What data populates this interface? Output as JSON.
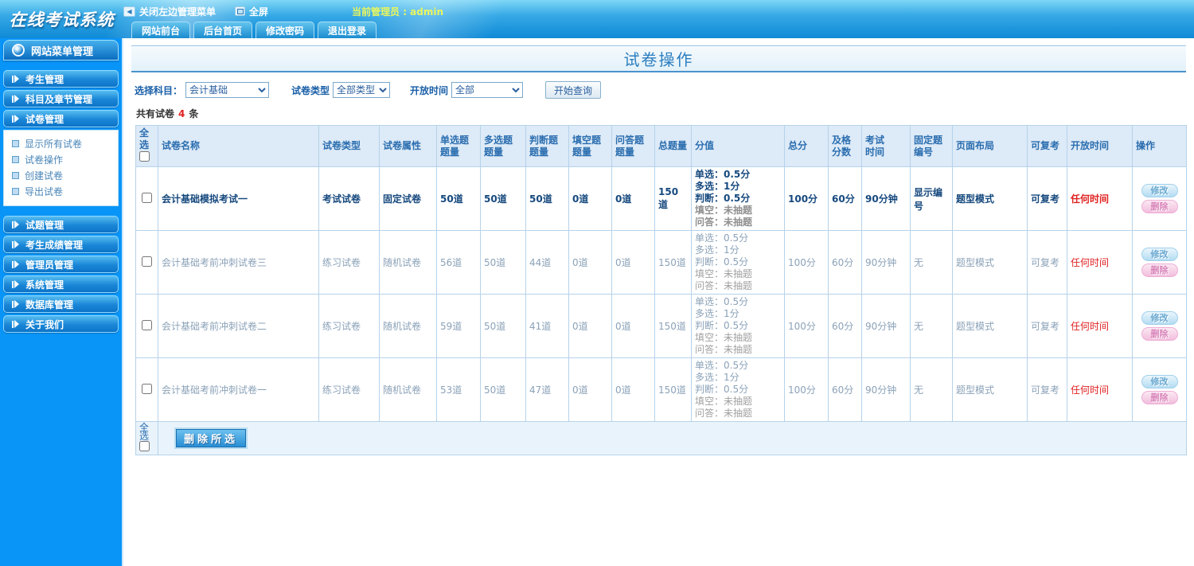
{
  "app": {
    "logo": "在线考试系统"
  },
  "topbar": {
    "close_menu": "关闭左边管理菜单",
    "fullscreen": "全屏",
    "admin_label": "当前管理员 : admin",
    "tabs": [
      "网站前台",
      "后台首页",
      "修改密码",
      "退出登录"
    ]
  },
  "sidebar": {
    "header": "网站菜单管理",
    "items": [
      {
        "label": "考生管理"
      },
      {
        "label": "科目及章节管理"
      },
      {
        "label": "试卷管理",
        "children": [
          "显示所有试卷",
          "试卷操作",
          "创建试卷",
          "导出试卷"
        ]
      },
      {
        "label": "试题管理"
      },
      {
        "label": "考生成绩管理"
      },
      {
        "label": "管理员管理"
      },
      {
        "label": "系统管理"
      },
      {
        "label": "数据库管理"
      },
      {
        "label": "关于我们"
      }
    ]
  },
  "main": {
    "title": "试卷操作",
    "filters": {
      "subject_label": "选择科目：",
      "subject_value": "会计基础",
      "type_label": "试卷类型",
      "type_value": "全部类型",
      "time_label": "开放时间",
      "time_value": "全部",
      "search_button": "开始查询"
    },
    "count": {
      "prefix": "共有试卷",
      "value": "4",
      "suffix": "条"
    },
    "table": {
      "headers": [
        "全选",
        "试卷名称",
        "试卷类型",
        "试卷属性",
        "单选题\n题量",
        "多选题\n题量",
        "判断题\n题量",
        "填空题\n题量",
        "问答题\n题量",
        "总题量",
        "分值",
        "总分",
        "及格\n分数",
        "考试\n时间",
        "固定题\n编号",
        "页面布局",
        "可复考",
        "开放时间",
        "操作"
      ],
      "actions": {
        "edit": "修改",
        "delete": "删除"
      },
      "footer": {
        "select_all": "全选",
        "delete_selected": "删除所选"
      },
      "rows": [
        {
          "bold": true,
          "name": "会计基础模拟考试一",
          "type": "考试试卷",
          "attr": "固定试卷",
          "single": "50道",
          "multi": "50道",
          "judge": "50道",
          "blank": "0道",
          "qa": "0道",
          "total": "150道",
          "score_main": [
            "单选：0.5分",
            "多选：1分",
            "判断：0.5分"
          ],
          "score_gray": [
            "填空：未抽题",
            "问答：未抽题"
          ],
          "total_score": "100分",
          "pass_score": "60分",
          "time": "90分钟",
          "fixed_no": "显示编号",
          "layout": "题型模式",
          "retake": "可复考",
          "open_time": "任何时间"
        },
        {
          "bold": false,
          "name": "会计基础考前冲刺试卷三",
          "type": "练习试卷",
          "attr": "随机试卷",
          "single": "56道",
          "multi": "50道",
          "judge": "44道",
          "blank": "0道",
          "qa": "0道",
          "total": "150道",
          "score_main": [
            "单选：0.5分",
            "多选：1分",
            "判断：0.5分"
          ],
          "score_gray": [
            "填空：未抽题",
            "问答：未抽题"
          ],
          "total_score": "100分",
          "pass_score": "60分",
          "time": "90分钟",
          "fixed_no": "无",
          "layout": "题型模式",
          "retake": "可复考",
          "open_time": "任何时间"
        },
        {
          "bold": false,
          "name": "会计基础考前冲刺试卷二",
          "type": "练习试卷",
          "attr": "随机试卷",
          "single": "59道",
          "multi": "50道",
          "judge": "41道",
          "blank": "0道",
          "qa": "0道",
          "total": "150道",
          "score_main": [
            "单选：0.5分",
            "多选：1分",
            "判断：0.5分"
          ],
          "score_gray": [
            "填空：未抽题",
            "问答：未抽题"
          ],
          "total_score": "100分",
          "pass_score": "60分",
          "time": "90分钟",
          "fixed_no": "无",
          "layout": "题型模式",
          "retake": "可复考",
          "open_time": "任何时间"
        },
        {
          "bold": false,
          "name": "会计基础考前冲刺试卷一",
          "type": "练习试卷",
          "attr": "随机试卷",
          "single": "53道",
          "multi": "50道",
          "judge": "47道",
          "blank": "0道",
          "qa": "0道",
          "total": "150道",
          "score_main": [
            "单选：0.5分",
            "多选：1分",
            "判断：0.5分"
          ],
          "score_gray": [
            "填空：未抽题",
            "问答：未抽题"
          ],
          "total_score": "100分",
          "pass_score": "60分",
          "time": "90分钟",
          "fixed_no": "无",
          "layout": "题型模式",
          "retake": "可复考",
          "open_time": "任何时间"
        }
      ]
    },
    "colors": {
      "accent_blue": "#0995f8",
      "header_text": "#2a6daf",
      "highlight_red": "#e02020",
      "admin_yellow": "#e9f65e"
    }
  }
}
